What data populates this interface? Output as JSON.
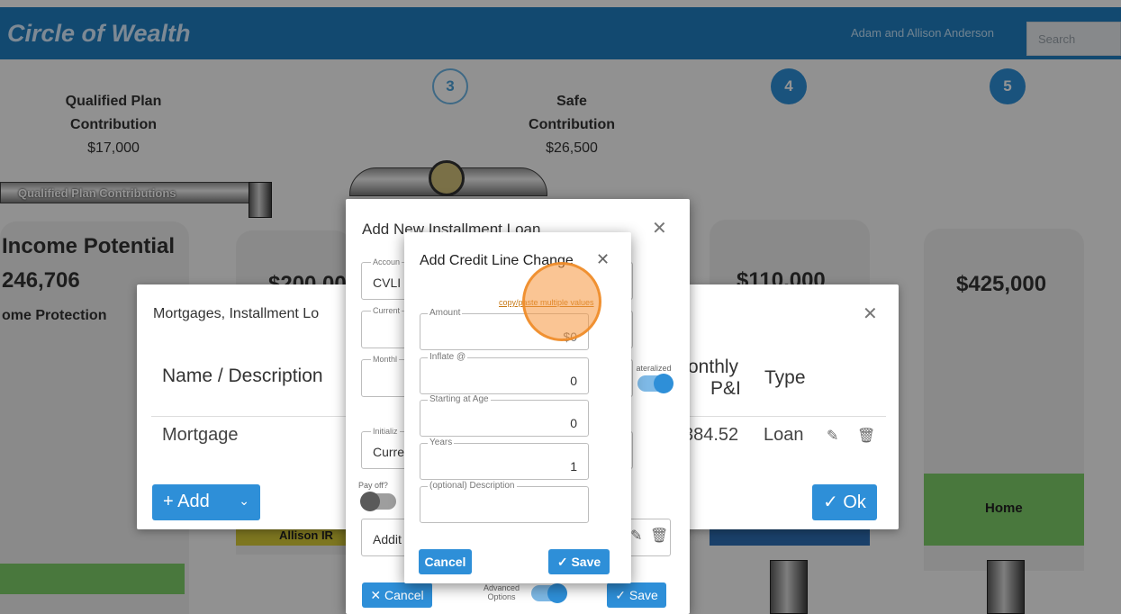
{
  "header": {
    "app_title": "Circle of Wealth",
    "user_name": "Adam and Allison Anderson",
    "search_placeholder": "Search"
  },
  "scene": {
    "steps": [
      "3",
      "4",
      "5"
    ],
    "qualified_plan": {
      "line1": "Qualified Plan",
      "line2": "Contribution",
      "amount": "$17,000"
    },
    "safe": {
      "line1": "Safe",
      "line2": "Contribution",
      "amount": "$26,500"
    },
    "pipe_label": "Qualified Plan Contributions",
    "income_potential": "Income Potential",
    "income_value": "246,706",
    "home_protection": "ome Protection",
    "tank_value_2": "$200,00",
    "tank_value_4": "$110,000",
    "tank_value_5": "$425,000",
    "tank_label_allison": "Allison IR",
    "tank_label_home": "Home"
  },
  "mortgages_panel": {
    "title": "Mortgages, Installment Lo",
    "columns": {
      "name": "Name / Description",
      "monthly_1": "onthly",
      "monthly_2": "P&I",
      "type": "Type"
    },
    "row": {
      "name": "Mortgage",
      "monthly": "384.52",
      "type": "Loan"
    },
    "add_label": "+ Add",
    "ok_label": "✓ Ok"
  },
  "installment_modal": {
    "title": "Add New Installment Loan",
    "fields": [
      {
        "label": "Accoun",
        "value": "CVLI"
      },
      {
        "label": "Current",
        "value": ""
      },
      {
        "label": "Monthl",
        "value": ""
      },
      {
        "label": "Initializ",
        "value": "Curre"
      },
      {
        "label": "",
        "value": "Addit"
      }
    ],
    "collateralized_label": "ateralized",
    "pay_off_label": "Pay off?",
    "advanced_options_label": "Advanced Options",
    "cancel_label": "✕ Cancel",
    "save_label": "✓ Save"
  },
  "credit_line_dialog": {
    "title": "Add Credit Line Change",
    "copy_link": "copy/paste multiple values",
    "fields": [
      {
        "label": "Amount",
        "value": "$0"
      },
      {
        "label": "Inflate @",
        "value": "0"
      },
      {
        "label": "Starting at Age",
        "value": "0"
      },
      {
        "label": "Years",
        "value": "1"
      },
      {
        "label": "(optional) Description",
        "value": ""
      }
    ],
    "cancel_label": "Cancel",
    "save_label": "✓ Save"
  }
}
